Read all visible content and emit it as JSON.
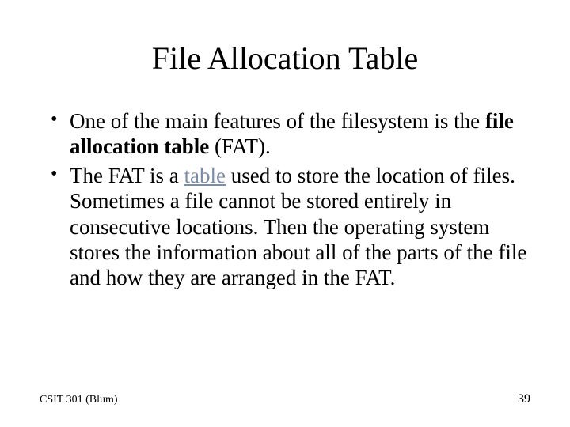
{
  "title": "File Allocation Table",
  "bullets": {
    "b1_pre": "One of the main features of the filesystem is the ",
    "b1_bold": "file allocation table",
    "b1_post": " (FAT).",
    "b2_pre": "The FAT is a  ",
    "b2_link": "table",
    "b2_post": " used to store the location of files.  Sometimes a file cannot be stored entirely in consecutive locations. Then the operating system stores the information about all of the parts of the file and how they are arranged in the FAT."
  },
  "footer": {
    "left": "CSIT 301 (Blum)",
    "right": "39"
  }
}
